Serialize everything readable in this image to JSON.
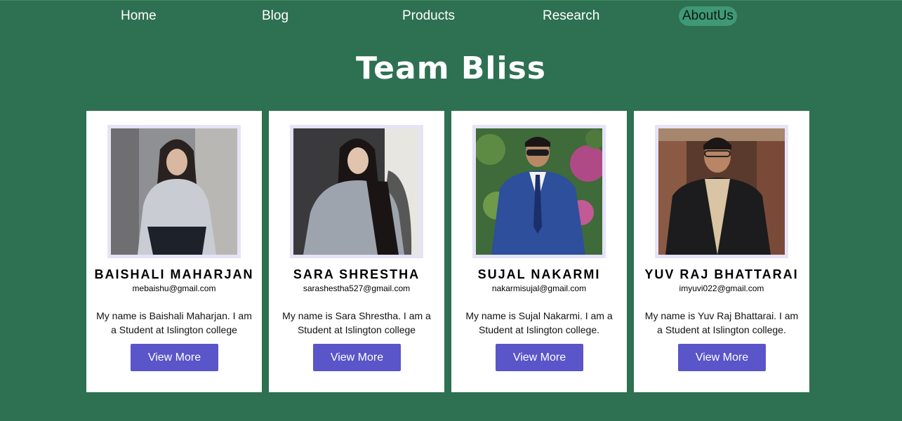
{
  "nav": {
    "items": [
      {
        "label": "Home"
      },
      {
        "label": "Blog"
      },
      {
        "label": "Products"
      },
      {
        "label": "Research"
      },
      {
        "label": "AboutUs",
        "active": true
      }
    ]
  },
  "page_title": "Team Bliss",
  "members": [
    {
      "name": "BAISHALI MAHARJAN",
      "email": "mebaishu@gmail.com",
      "bio": "My name is Baishali Maharjan. I am a Student at Islington college",
      "button_label": "View More"
    },
    {
      "name": "SARA SHRESTHA",
      "email": "sarashestha527@gmail.com",
      "bio": "My name is Sara Shrestha. I am a Student at Islington college",
      "button_label": "View More"
    },
    {
      "name": "SUJAL NAKARMI",
      "email": "nakarmisujal@gmail.com",
      "bio": "My name is Sujal Nakarmi. I am a Student at Islington college.",
      "button_label": "View More"
    },
    {
      "name": "YUV RAJ BHATTARAI",
      "email": "imyuvi022@gmail.com",
      "bio": "My name is Yuv Raj Bhattarai. I am a Student at Islington college.",
      "button_label": "View More"
    }
  ],
  "footer_heading": "",
  "colors": {
    "background": "#2e7052",
    "active_nav_pill": "#3f9876",
    "button": "#5a55c8",
    "photo_frame": "#e6e3f7"
  }
}
